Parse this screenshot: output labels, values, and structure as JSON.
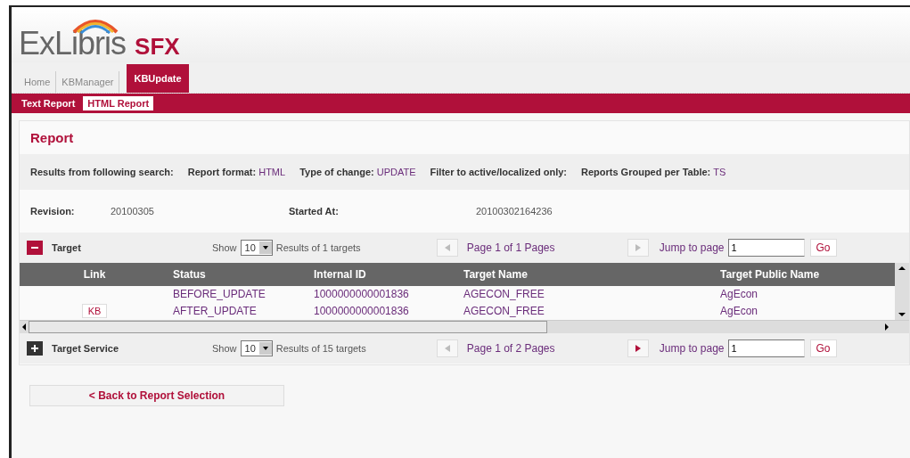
{
  "logo": {
    "brand": "ExLibris",
    "product": "SFX"
  },
  "tabs": [
    {
      "label": "Home",
      "selected": false
    },
    {
      "label": "KBManager",
      "selected": false
    },
    {
      "label": "KBUpdate",
      "selected": true
    }
  ],
  "subtabs": [
    {
      "label": "Text Report",
      "selected": false
    },
    {
      "label": "HTML Report",
      "selected": true
    }
  ],
  "report": {
    "title": "Report",
    "search_info": [
      {
        "label": "Results from following search:"
      },
      {
        "label": "Report format:",
        "value": "HTML"
      },
      {
        "label": "Type of change:",
        "value": "UPDATE"
      },
      {
        "label": "Filter to active/localized only:"
      },
      {
        "label": "Reports Grouped per Table:",
        "value": "TS"
      }
    ],
    "revision": {
      "label": "Revision:",
      "value": "20100305"
    },
    "started": {
      "label": "Started At:",
      "value": "20100302164236"
    },
    "sections": [
      {
        "title": "Target",
        "expanded": true,
        "show_label": "Show",
        "show_value": "10",
        "results": "Results of 1 targets",
        "page": "Page 1 of 1 Pages",
        "prev_enabled": false,
        "next_enabled": false,
        "jump_label": "Jump to page",
        "jump_value": "1",
        "go": "Go",
        "table": {
          "columns": [
            "Link",
            "Status",
            "Internal ID",
            "Target Name",
            "Target Public Name"
          ],
          "rows": [
            {
              "link": null,
              "status": "BEFORE_UPDATE",
              "internal_id": "1000000000001836",
              "target_name": "AGECON_FREE",
              "public_name": "AgEcon"
            },
            {
              "link": "KB",
              "status": "AFTER_UPDATE",
              "internal_id": "1000000000001836",
              "target_name": "AGECON_FREE",
              "public_name": "AgEcon"
            }
          ]
        }
      },
      {
        "title": "Target Service",
        "expanded": false,
        "show_label": "Show",
        "show_value": "10",
        "results": "Results of 15 targets",
        "page": "Page 1 of 2 Pages",
        "prev_enabled": false,
        "next_enabled": true,
        "jump_label": "Jump to page",
        "jump_value": "1",
        "go": "Go"
      }
    ],
    "back_button": "< Back to Report Selection"
  }
}
